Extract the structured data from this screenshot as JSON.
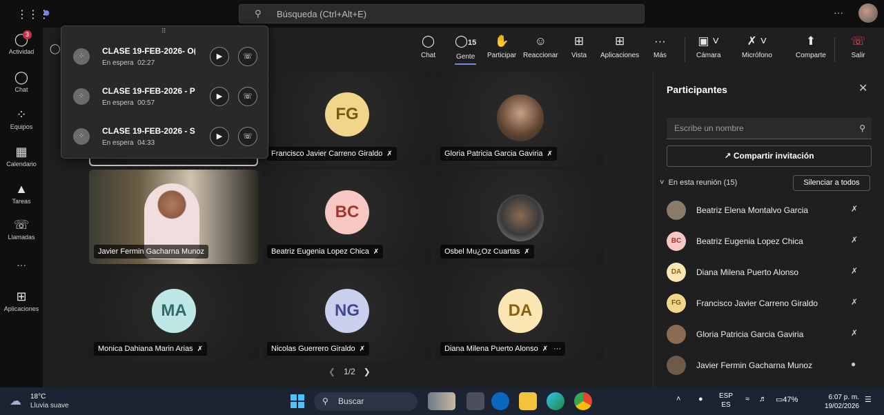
{
  "topbar": {
    "search_placeholder": "Búsqueda (Ctrl+Alt+E)",
    "more": "···"
  },
  "rail": [
    {
      "label": "Actividad",
      "icon": "bell-icon",
      "badge": "3"
    },
    {
      "label": "Chat",
      "icon": "chat-icon"
    },
    {
      "label": "Equipos",
      "icon": "teams-icon"
    },
    {
      "label": "Calendario",
      "icon": "calendar-icon"
    },
    {
      "label": "Tareas",
      "icon": "tasks-icon"
    },
    {
      "label": "Llamadas",
      "icon": "phone-icon"
    },
    {
      "label": "···",
      "icon": "more-icon"
    },
    {
      "label": "Aplicaciones",
      "icon": "plus-box-icon"
    }
  ],
  "toolbar": {
    "chat": "Chat",
    "people": "Gente",
    "people_count": "15",
    "raise": "Participar",
    "react": "Reaccionar",
    "view": "Vista",
    "apps": "Aplicaciones",
    "more": "Más",
    "camera": "Cámara",
    "mic": "Micrófono",
    "share": "Comparte",
    "leave": "Salir"
  },
  "hold_calls": [
    {
      "title": "CLASE 19-FEB-2026- O(",
      "status": "En espera",
      "time": "02:27"
    },
    {
      "title": "CLASE 19-FEB-2026 - P",
      "status": "En espera",
      "time": "00:57"
    },
    {
      "title": "CLASE 19-FEB-2026 - S",
      "status": "En espera",
      "time": "04:33"
    }
  ],
  "tiles": [
    {
      "name": "Francisco Javier Carreno Giraldo",
      "initials": "FG",
      "bg": "#f0d58a",
      "fg": "#7a5a12"
    },
    {
      "name": "Gloria Patricia Garcia Gaviria",
      "initials": "",
      "bg": "#8a6a50",
      "fg": "#fff"
    },
    {
      "name": "Javier Fermin Gacharna Munoz",
      "initials": "",
      "bg": "#6e5a48",
      "fg": "#fff"
    },
    {
      "name": "Beatriz Eugenia Lopez Chica",
      "initials": "BC",
      "bg": "#f6c7c3",
      "fg": "#a3372f"
    },
    {
      "name": "Osbel Mu¿Oz Cuartas",
      "initials": "",
      "bg": "#777",
      "fg": "#fff"
    },
    {
      "name": "Monica Dahiana Marin Arias",
      "initials": "MA",
      "bg": "#bfe7e6",
      "fg": "#2d6e6c"
    },
    {
      "name": "Nicolas Guerrero Giraldo",
      "initials": "NG",
      "bg": "#cbcfee",
      "fg": "#414a8f"
    },
    {
      "name": "Diana Milena Puerto Alonso",
      "initials": "DA",
      "bg": "#fbe6b4",
      "fg": "#8a6010"
    }
  ],
  "pager": {
    "text": "1/2"
  },
  "panel": {
    "title": "Participantes",
    "search_placeholder": "Escribe un nombre",
    "share": "Compartir invitación",
    "section": "En esta reunión (15)",
    "mute_all": "Silenciar a todos",
    "people": [
      {
        "name": "Beatriz Elena Montalvo Garcia",
        "initials": "",
        "bg": "#8a7a6a",
        "fg": "#fff",
        "mic": "muted"
      },
      {
        "name": "Beatriz Eugenia Lopez Chica",
        "initials": "BC",
        "bg": "#f6c7c3",
        "fg": "#a3372f",
        "mic": "muted"
      },
      {
        "name": "Diana Milena Puerto Alonso",
        "initials": "DA",
        "bg": "#fbe6b4",
        "fg": "#8a6010",
        "mic": "muted"
      },
      {
        "name": "Francisco Javier Carreno Giraldo",
        "initials": "FG",
        "bg": "#f0d58a",
        "fg": "#7a5a12",
        "mic": "muted"
      },
      {
        "name": "Gloria Patricia Garcia Gaviria",
        "initials": "",
        "bg": "#8a6a50",
        "fg": "#fff",
        "mic": "muted"
      },
      {
        "name": "Javier Fermin Gacharna Munoz",
        "initials": "",
        "bg": "#6e5a48",
        "fg": "#fff",
        "mic": "on"
      }
    ]
  },
  "taskbar": {
    "temp": "18°C",
    "weather": "Lluvia suave",
    "search": "Buscar",
    "lang1": "ESP",
    "lang2": "ES",
    "battery": "47%",
    "time": "6:07 p. m.",
    "date": "19/02/2026"
  }
}
